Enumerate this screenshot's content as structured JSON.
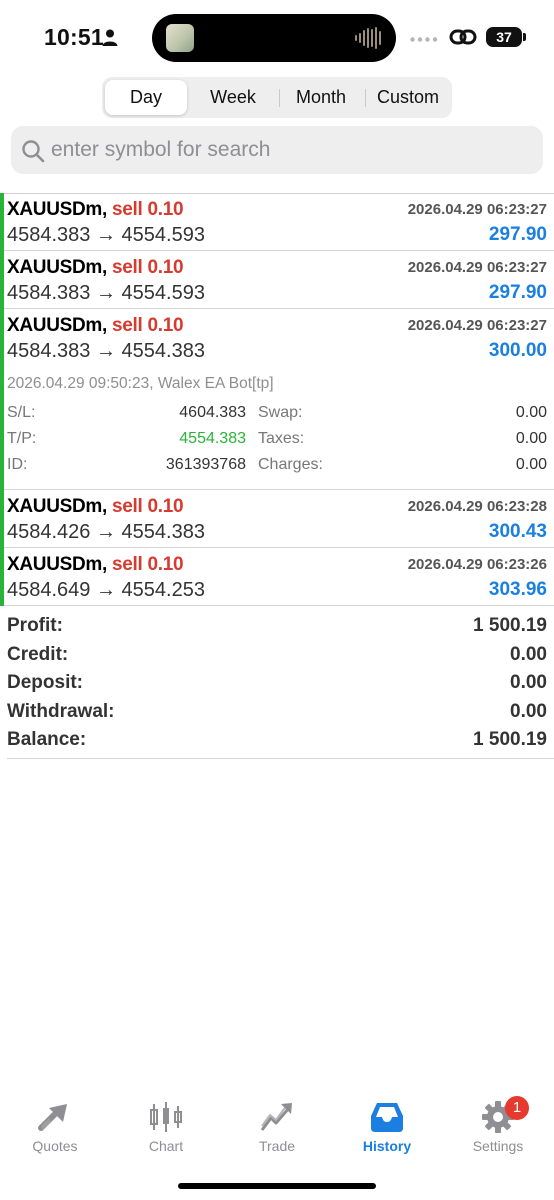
{
  "status_bar": {
    "time": "10:51",
    "battery": "37"
  },
  "period_tabs": [
    {
      "label": "Day",
      "active": true
    },
    {
      "label": "Week",
      "active": false
    },
    {
      "label": "Month",
      "active": false
    },
    {
      "label": "Custom",
      "active": false
    }
  ],
  "search": {
    "placeholder": "enter symbol for search",
    "value": ""
  },
  "deals": [
    {
      "symbol": "XAUUSDm,",
      "type": "sell 0.10",
      "time": "2026.04.29 06:23:27",
      "prices": "4584.383 → 4554.593",
      "profit": "297.90"
    },
    {
      "symbol": "XAUUSDm,",
      "type": "sell 0.10",
      "time": "2026.04.29 06:23:27",
      "prices": "4584.383 → 4554.593",
      "profit": "297.90"
    },
    {
      "symbol": "XAUUSDm,",
      "type": "sell 0.10",
      "time": "2026.04.29 06:23:27",
      "prices": "4584.383 → 4554.383",
      "profit": "300.00"
    },
    {
      "symbol": "XAUUSDm,",
      "type": "sell 0.10",
      "time": "2026.04.29 06:23:28",
      "prices": "4584.426 → 4554.383",
      "profit": "300.43"
    },
    {
      "symbol": "XAUUSDm,",
      "type": "sell 0.10",
      "time": "2026.04.29 06:23:26",
      "prices": "4584.649 → 4554.253",
      "profit": "303.96"
    }
  ],
  "detail": {
    "comment": "2026.04.29 09:50:23, Walex EA Bot[tp]",
    "sl_label": "S/L:",
    "sl_value": "4604.383",
    "tp_label": "T/P:",
    "tp_value": "4554.383",
    "id_label": "ID:",
    "id_value": "361393768",
    "swap_label": "Swap:",
    "swap_value": "0.00",
    "taxes_label": "Taxes:",
    "taxes_value": "0.00",
    "charges_label": "Charges:",
    "charges_value": "0.00"
  },
  "totals": [
    {
      "label": "Profit:",
      "value": "1 500.19"
    },
    {
      "label": "Credit:",
      "value": "0.00"
    },
    {
      "label": "Deposit:",
      "value": "0.00"
    },
    {
      "label": "Withdrawal:",
      "value": "0.00"
    },
    {
      "label": "Balance:",
      "value": "1 500.19"
    }
  ],
  "tabbar": [
    {
      "label": "Quotes",
      "icon": "quotes-icon",
      "active": false
    },
    {
      "label": "Chart",
      "icon": "candlestick-icon",
      "active": false
    },
    {
      "label": "Trade",
      "icon": "trade-icon",
      "active": false
    },
    {
      "label": "History",
      "icon": "inbox-icon",
      "active": true
    },
    {
      "label": "Settings",
      "icon": "gear-icon",
      "active": false,
      "badge": "1"
    }
  ],
  "colors": {
    "accent": "#1a7fe0",
    "sell": "#d73a2e",
    "positive": "#2ab33a",
    "badge": "#e63a2e"
  }
}
